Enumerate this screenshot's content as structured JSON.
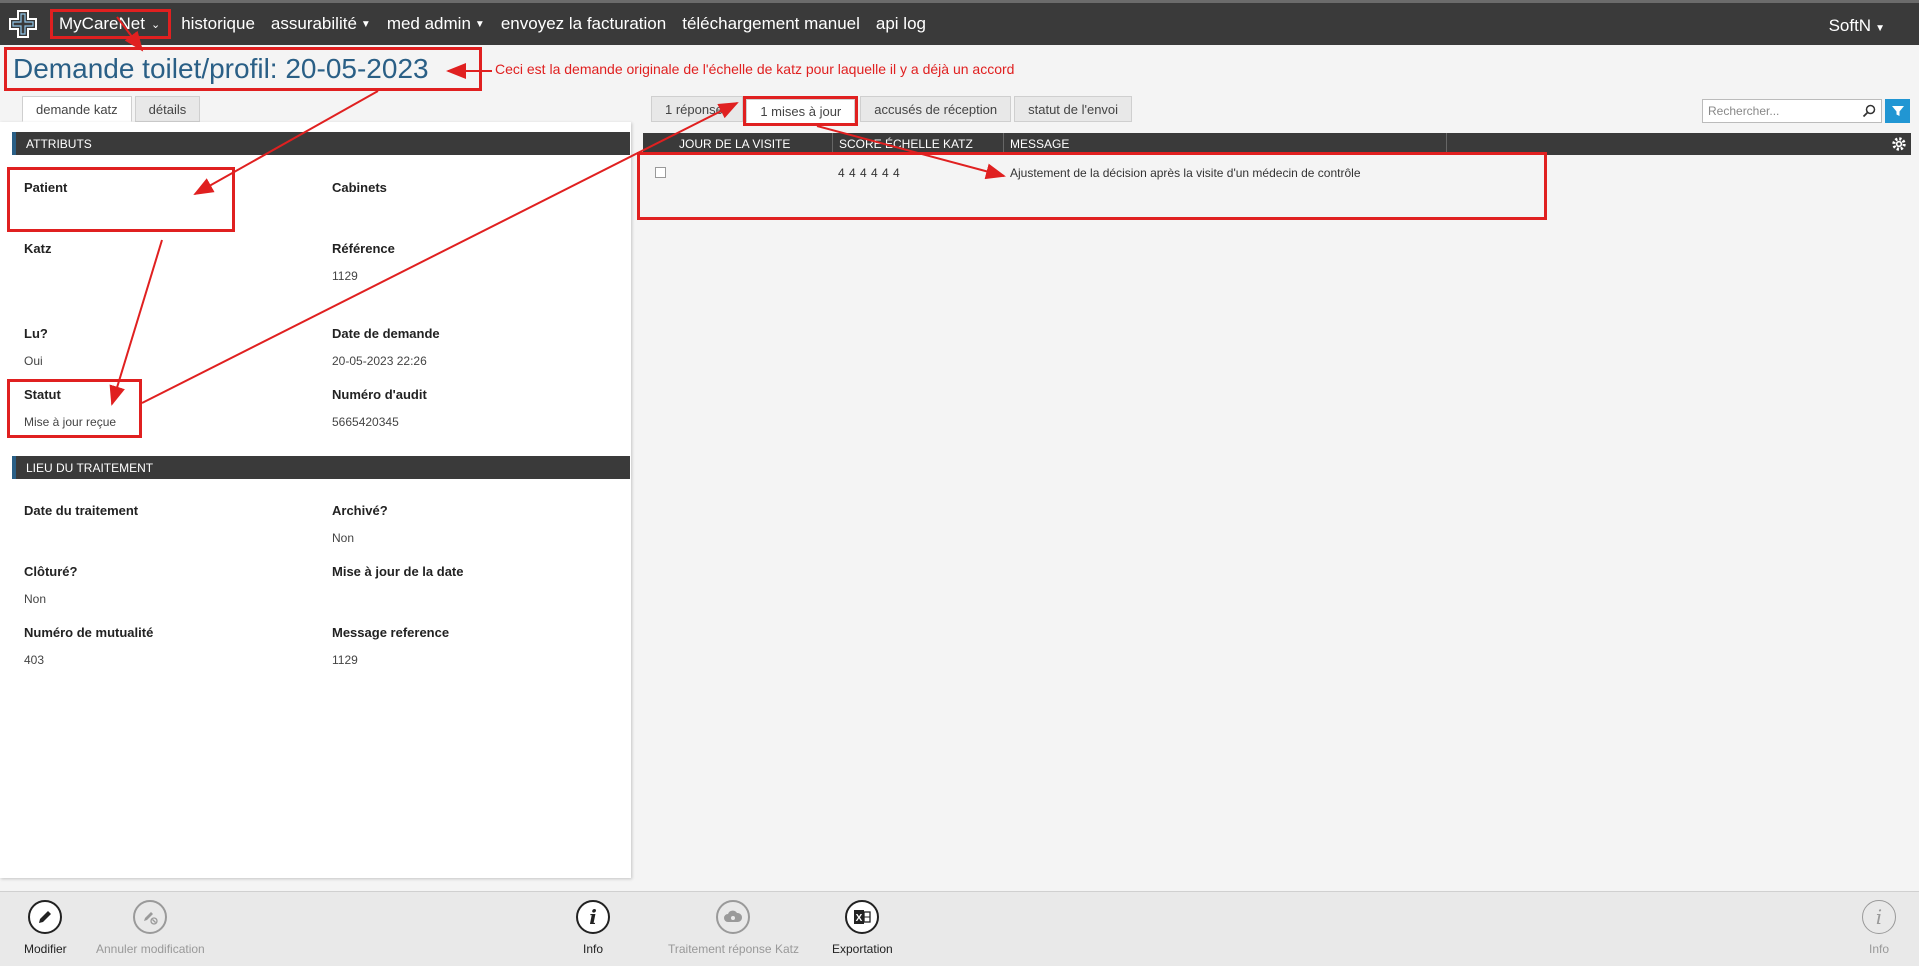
{
  "nav": {
    "brand": "MyCareNet",
    "items": [
      {
        "label": "historique",
        "dropdown": false
      },
      {
        "label": "assurabilité",
        "dropdown": true
      },
      {
        "label": "med admin",
        "dropdown": true
      },
      {
        "label": "envoyez la facturation",
        "dropdown": false
      },
      {
        "label": "téléchargement manuel",
        "dropdown": false
      },
      {
        "label": "api log",
        "dropdown": false
      }
    ],
    "user": "SoftN"
  },
  "page": {
    "title": "Demande toilet/profil: 20-05-2023",
    "annotation": "Ceci est la demande originale de l'échelle de katz pour laquelle il y a déjà un accord"
  },
  "left_tabs": [
    "demande katz",
    "détails"
  ],
  "attributes": {
    "header": "ATTRIBUTS",
    "fields": {
      "patient": {
        "label": "Patient",
        "value": ""
      },
      "cabinets": {
        "label": "Cabinets",
        "value": ""
      },
      "katz": {
        "label": "Katz",
        "value": ""
      },
      "reference": {
        "label": "Référence",
        "value": "1129"
      },
      "lu": {
        "label": "Lu?",
        "value": "Oui"
      },
      "date_demande": {
        "label": "Date de demande",
        "value": "20-05-2023 22:26"
      },
      "statut": {
        "label": "Statut",
        "value": "Mise à jour reçue"
      },
      "audit": {
        "label": "Numéro d'audit",
        "value": "5665420345"
      }
    }
  },
  "treatment": {
    "header": "LIEU DU TRAITEMENT",
    "fields": {
      "date_traitement": {
        "label": "Date du traitement",
        "value": ""
      },
      "archive": {
        "label": "Archivé?",
        "value": "Non"
      },
      "cloture": {
        "label": "Clôturé?",
        "value": "Non"
      },
      "mise_a_jour_date": {
        "label": "Mise à jour de la date",
        "value": ""
      },
      "mutualite": {
        "label": "Numéro de mutualité",
        "value": "403"
      },
      "message_ref": {
        "label": "Message reference",
        "value": "1129"
      }
    }
  },
  "right_tabs": [
    "1 réponses",
    "1 mises à jour",
    "accusés de réception",
    "statut de l'envoi"
  ],
  "search": {
    "placeholder": "Rechercher..."
  },
  "grid": {
    "columns": [
      "JOUR DE LA VISITE",
      "SCORE ÉCHELLE KATZ",
      "MESSAGE"
    ],
    "rows": [
      {
        "jour": "",
        "score": "4 4 4 4 4 4",
        "message": "Ajustement de la décision après la visite d'un médecin de contrôle"
      }
    ]
  },
  "toolbar": {
    "modifier": "Modifier",
    "annuler": "Annuler modification",
    "info": "Info",
    "traitement": "Traitement réponse Katz",
    "exportation": "Exportation",
    "info_right": "Info"
  },
  "colors": {
    "nav_bg": "#3a3a3a",
    "title": "#2a5f86",
    "annotation_red": "#e02020",
    "accent_blue": "#2196d3"
  }
}
